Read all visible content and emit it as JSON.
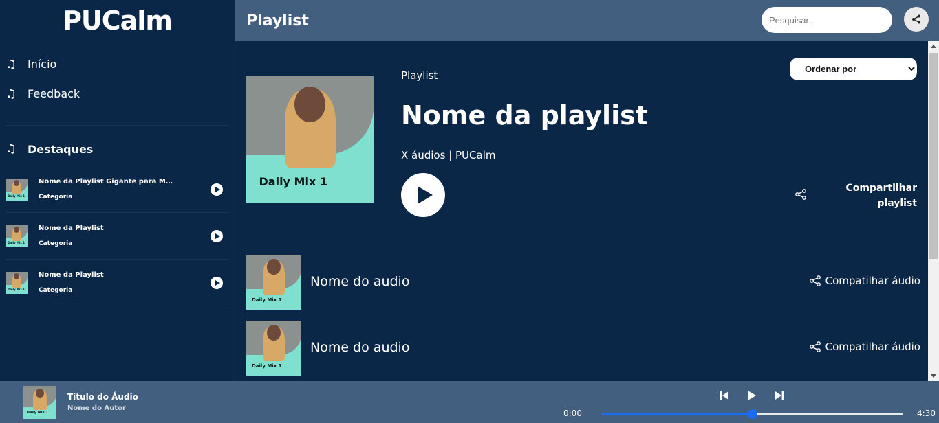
{
  "app": {
    "logo": "PUCalm"
  },
  "sidebar": {
    "nav": [
      {
        "label": "Início",
        "icon": "music-note-icon"
      },
      {
        "label": "Feedback",
        "icon": "music-note-icon"
      }
    ],
    "section_title": "Destaques",
    "featured": [
      {
        "title": "Nome da Playlist Gigante para Med...",
        "category": "Categoria",
        "thumb_label": "Daily Mix 1"
      },
      {
        "title": "Nome da Playlist",
        "category": "Categoria",
        "thumb_label": "Daily Mix 1"
      },
      {
        "title": "Nome da Playlist",
        "category": "Categoria",
        "thumb_label": "Daily Mix 1"
      }
    ]
  },
  "header": {
    "title": "Playlist",
    "search_placeholder": "Pesquisar.."
  },
  "playlist": {
    "kind": "Playlist",
    "name": "Nome da playlist",
    "meta": "X áudios | PUCalm",
    "cover_label": "Daily Mix 1",
    "order_label": "Ordenar por",
    "share_label": "Compartilhar playlist"
  },
  "audios": [
    {
      "name": "Nome do audio",
      "share_label": "Compatilhar áudio",
      "thumb_label": "Daily Mix 1"
    },
    {
      "name": "Nome do audio",
      "share_label": "Compatilhar áudio",
      "thumb_label": "Daily Mix 1"
    }
  ],
  "player": {
    "title": "Título do Áudio",
    "author": "Nome do Autor",
    "thumb_label": "Daily Mix 1",
    "current_time": "0:00",
    "total_time": "4:30",
    "progress_percent": 50
  },
  "colors": {
    "background": "#0b2747",
    "header": "#435f7f",
    "accent": "#1a6cf0"
  }
}
